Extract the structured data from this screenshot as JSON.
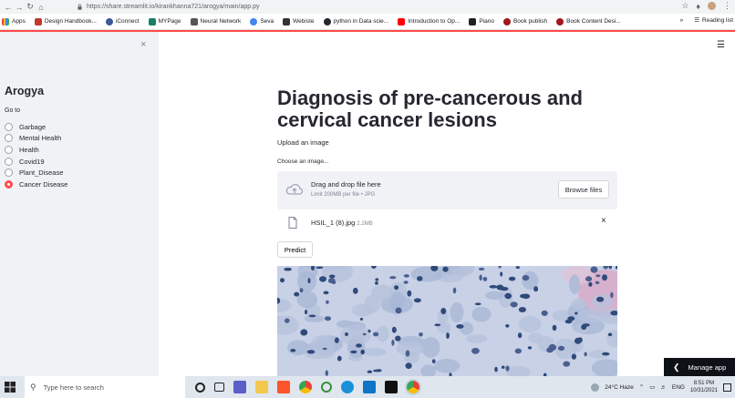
{
  "browser": {
    "url": "https://share.streamlit.io/kirankhanna721/arogya/main/app.py",
    "bookmarks": [
      "Apps",
      "Design Handbook...",
      "iConnect",
      "MYPage",
      "Neural Network",
      "Seva",
      "Webiste",
      "python in Data scie...",
      "Introduction to Op...",
      "Piano",
      "Book publish",
      "Book Content Desi..."
    ],
    "more": "»",
    "reading_list": "Reading list"
  },
  "sidebar": {
    "close": "×",
    "title": "Arogya",
    "goto_label": "Go to",
    "options": [
      "Garbage",
      "Mental Health",
      "Health",
      "Covid19",
      "Plant_Disease",
      "Cancer Disease"
    ],
    "selected_index": 5
  },
  "main": {
    "menu": "☰",
    "title": "Diagnosis of pre-cancerous and cervical cancer lesions",
    "upload_label": "Upload an image",
    "uploader": {
      "label": "Choose an image...",
      "drag_text": "Drag and drop file here",
      "limit_text": "Limit 200MB per file • JPG",
      "browse_label": "Browse files"
    },
    "file": {
      "name": "HSIL_1 (8).jpg",
      "size": "2.2MB",
      "remove": "×"
    },
    "predict_label": "Predict",
    "manage_app_label": "Manage app"
  },
  "taskbar": {
    "search_placeholder": "Type here to search",
    "weather": "24°C  Haze",
    "lang": "ENG",
    "time": "8:51 PM",
    "date": "10/31/2021"
  },
  "colors": {
    "accent": "#ff4b4b",
    "sidebar_bg": "#f0f2f6",
    "manage_bg": "#0e1117"
  }
}
